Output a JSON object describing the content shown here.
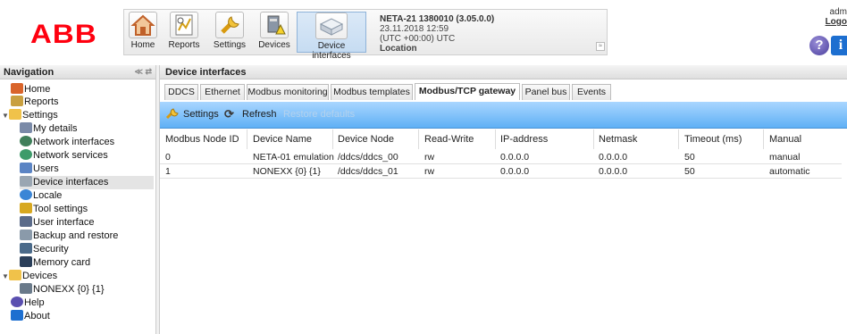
{
  "header": {
    "logo": "ABB",
    "toolbar": {
      "buttons": [
        {
          "label": "Home",
          "icon": "home-icon"
        },
        {
          "label": "Reports",
          "icon": "reports-icon"
        },
        {
          "label": "Settings",
          "icon": "settings-icon"
        },
        {
          "label": "Devices",
          "icon": "devices-icon"
        },
        {
          "label": "Device interfaces",
          "icon": "device-interfaces-icon"
        }
      ],
      "device": {
        "title": "NETA-21 1380010 (3.05.0.0)",
        "datetime": "23.11.2018 12:59",
        "timezone": "(UTC +00:00) UTC",
        "location": "Location"
      },
      "collapse_glyph": "≈"
    },
    "user": "adm",
    "logout": "Logo",
    "help_glyph": "?",
    "info_glyph": "i"
  },
  "nav": {
    "title": "Navigation",
    "controls": "≪ ⇄",
    "items": [
      {
        "label": "Home",
        "icon": "home-icon",
        "color": "#d9642a"
      },
      {
        "label": "Reports",
        "icon": "reports-icon",
        "color": "#c9a040"
      },
      {
        "label": "Settings",
        "icon": "folder-icon",
        "color": "#f0c24a"
      },
      {
        "label": "My details",
        "icon": "user-details-icon",
        "color": "#7a8aa8"
      },
      {
        "label": "Network interfaces",
        "icon": "network-icon",
        "color": "#3f7f5a"
      },
      {
        "label": "Network services",
        "icon": "network-services-icon",
        "color": "#3e9b6a"
      },
      {
        "label": "Users",
        "icon": "users-icon",
        "color": "#5b84c4"
      },
      {
        "label": "Device interfaces",
        "icon": "device-interfaces-icon",
        "color": "#9aa6b2"
      },
      {
        "label": "Locale",
        "icon": "locale-icon",
        "color": "#3b86d6"
      },
      {
        "label": "Tool settings",
        "icon": "tool-icon",
        "color": "#d7a820"
      },
      {
        "label": "User interface",
        "icon": "user-interface-icon",
        "color": "#5a6b8a"
      },
      {
        "label": "Backup and restore",
        "icon": "backup-icon",
        "color": "#8a9aaa"
      },
      {
        "label": "Security",
        "icon": "security-icon",
        "color": "#4a6a8a"
      },
      {
        "label": "Memory card",
        "icon": "memory-card-icon",
        "color": "#2a3f5a"
      },
      {
        "label": "Devices",
        "icon": "folder-icon",
        "color": "#f0c24a"
      },
      {
        "label": "NONEXX {0} {1}",
        "icon": "device-warning-icon",
        "color": "#6a7a8a"
      },
      {
        "label": "Help",
        "icon": "help-icon",
        "color": "#5a4fb0"
      },
      {
        "label": "About",
        "icon": "info-icon",
        "color": "#1d6fd0"
      }
    ]
  },
  "main": {
    "title": "Device interfaces",
    "tabs": [
      {
        "label": "DDCS"
      },
      {
        "label": "Ethernet"
      },
      {
        "label": "Modbus monitoring"
      },
      {
        "label": "Modbus templates"
      },
      {
        "label": "Modbus/TCP gateway"
      },
      {
        "label": "Panel bus"
      },
      {
        "label": "Events"
      }
    ],
    "actions": {
      "settings": "Settings",
      "refresh": "Refresh",
      "restore": "Restore defaults"
    },
    "table": {
      "columns": [
        "Modbus Node ID",
        "Device Name",
        "Device Node",
        "Read-Write",
        "IP-address",
        "Netmask",
        "Timeout (ms)",
        "Manual"
      ],
      "rows": [
        [
          "0",
          "NETA-01 emulation",
          "/ddcs/ddcs_00",
          "rw",
          "0.0.0.0",
          "0.0.0.0",
          "50",
          "manual"
        ],
        [
          "1",
          "NONEXX {0} {1}",
          "/ddcs/ddcs_01",
          "rw",
          "0.0.0.0",
          "0.0.0.0",
          "50",
          "automatic"
        ]
      ]
    }
  },
  "colors": {
    "brand": "#ff000f",
    "actionbar": "#5fb0f5",
    "active_toolbar": "#c6dcf2"
  }
}
